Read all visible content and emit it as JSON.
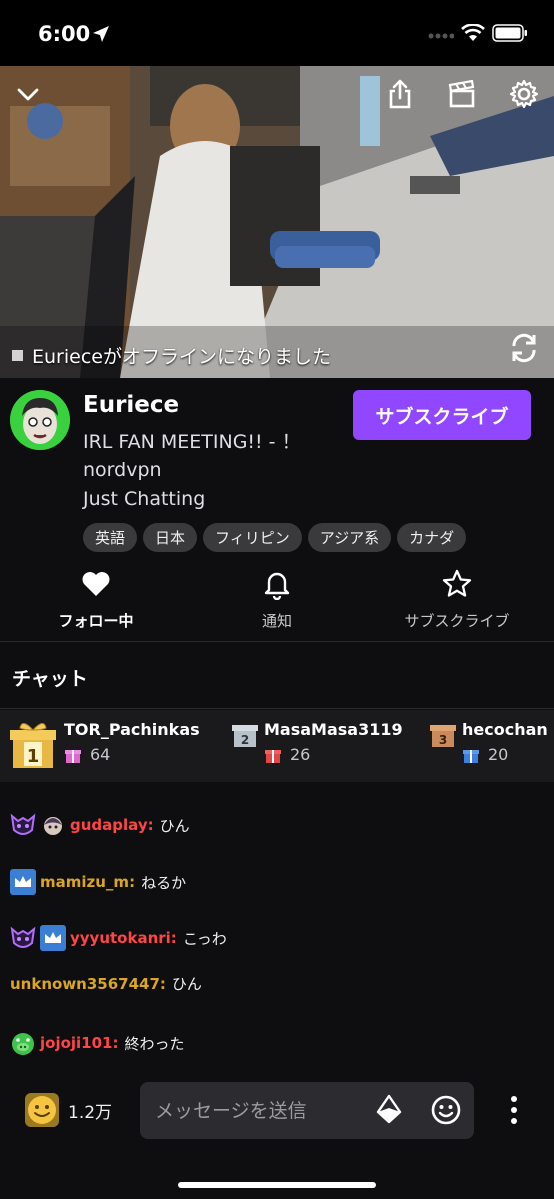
{
  "status_bar": {
    "time": "6:00"
  },
  "video": {
    "offline_message": "Eurieceがオフラインになりました"
  },
  "channel": {
    "name": "Euriece",
    "title": "IRL FAN MEETING!!  - ！nordvpn",
    "category": "Just Chatting",
    "subscribe_label": "サブスクライブ",
    "tags": [
      "英語",
      "日本",
      "フィリピン",
      "アジア系",
      "カナダ"
    ]
  },
  "actions": {
    "follow": "フォロー中",
    "notify": "通知",
    "subscribe": "サブスクライブ"
  },
  "chat": {
    "header": "チャット",
    "leaderboard": [
      {
        "name": "TOR_Pachinkas",
        "count": "64",
        "rank": "1"
      },
      {
        "name": "MasaMasa3119",
        "count": "26",
        "rank": "2"
      },
      {
        "name": "hecochan",
        "count": "20",
        "rank": "3"
      }
    ],
    "messages": [
      {
        "user": "gudaplay:",
        "text": "ひん",
        "color": "#ff4545"
      },
      {
        "user": "mamizu_m:",
        "text": "ねるか",
        "color": "#daa520"
      },
      {
        "user": "yyyutokanri:",
        "text": "こっわ",
        "color": "#ff4545"
      },
      {
        "user": "unknown3567447:",
        "text": "ひん",
        "color": "#daa520"
      },
      {
        "user": "jojoji101:",
        "text": "終わった",
        "color": "#ff4545"
      }
    ],
    "points": "1.2万",
    "input_placeholder": "メッセージを送信"
  },
  "colors": {
    "accent": "#9147ff",
    "background": "#0e0e10",
    "gold": "#daa520",
    "red": "#ff4545"
  },
  "icons": [
    "location-arrow-icon",
    "wifi-icon",
    "battery-icon",
    "chevron-down-icon",
    "share-icon",
    "clip-icon",
    "gear-icon",
    "rotate-icon",
    "heart-icon",
    "bell-icon",
    "star-icon",
    "gift-icon",
    "smiley-icon",
    "bits-icon",
    "emote-icon",
    "more-vertical-icon"
  ]
}
